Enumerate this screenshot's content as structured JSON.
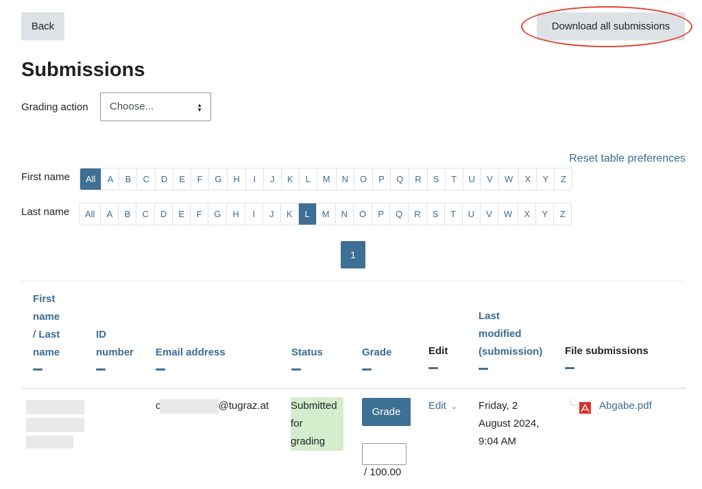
{
  "toolbar": {
    "back_label": "Back",
    "download_label": "Download all submissions"
  },
  "page": {
    "title": "Submissions",
    "grading_action_label": "Grading action",
    "grading_action_value": "Choose...",
    "reset_link": "Reset table preferences"
  },
  "filters": {
    "first_name_label": "First name",
    "last_name_label": "Last name",
    "letters": [
      "All",
      "A",
      "B",
      "C",
      "D",
      "E",
      "F",
      "G",
      "H",
      "I",
      "J",
      "K",
      "L",
      "M",
      "N",
      "O",
      "P",
      "Q",
      "R",
      "S",
      "T",
      "U",
      "V",
      "W",
      "X",
      "Y",
      "Z"
    ],
    "first_name_selected": "All",
    "last_name_selected": "L"
  },
  "pagination": {
    "current_page": "1"
  },
  "table": {
    "headers": {
      "first_name": "First",
      "first_name_2": "name",
      "separator": "/",
      "last_name": "Last",
      "last_name_2": "name",
      "id_1": "ID",
      "id_2": "number",
      "email": "Email address",
      "status": "Status",
      "grade": "Grade",
      "edit": "Edit",
      "last_modified_1": "Last",
      "last_modified_2": "modified",
      "last_modified_3": "(submission)",
      "file_submissions": "File submissions"
    },
    "rows": [
      {
        "email_prefix": "c",
        "email_suffix": "@tugraz.at",
        "status_1": "Submitted",
        "status_2": "for",
        "status_3": "grading",
        "grade_button": "Grade",
        "grade_value": "",
        "grade_max": "/ 100.00",
        "edit_label": "Edit",
        "edit_icon": "chevron-down-icon",
        "modified_1": "Friday, 2",
        "modified_2": "August 2024,",
        "modified_3": "9:04 AM",
        "file_name": "Abgabe.pdf",
        "file_icon": "pdf-icon"
      }
    ]
  },
  "colors": {
    "accent": "#3e6f94",
    "link": "#3a6c93",
    "status_submitted_bg": "#d4edcc",
    "highlight": "#e0412f"
  }
}
